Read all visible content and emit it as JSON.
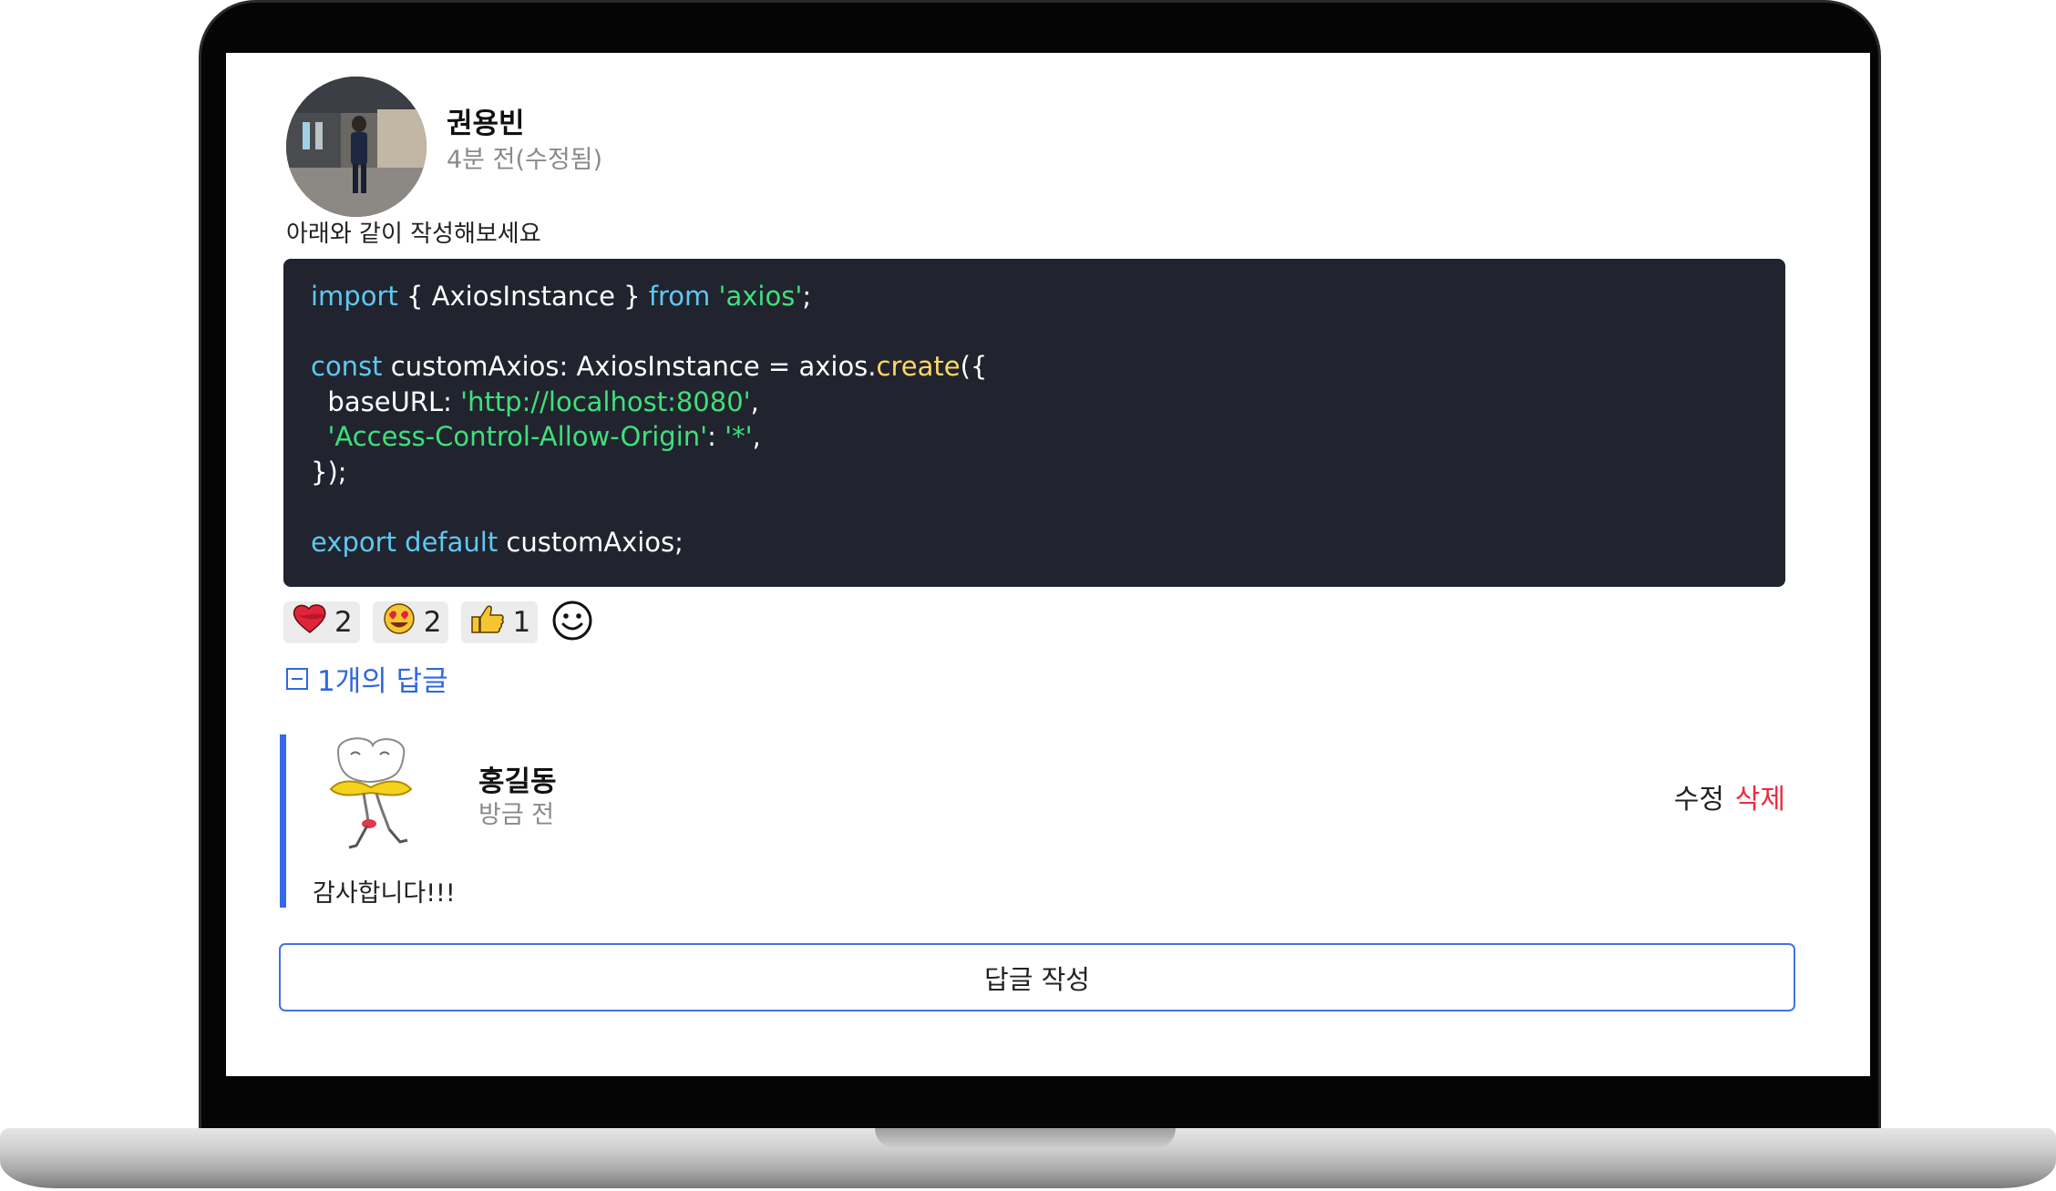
{
  "post": {
    "author": "권용빈",
    "time": "4분 전(수정됨)",
    "body": "아래와 같이 작성해보세요"
  },
  "code": {
    "lines": [
      [
        {
          "t": "import",
          "c": "kw"
        },
        {
          "t": " { AxiosInstance } ",
          "c": "punct"
        },
        {
          "t": "from",
          "c": "kw"
        },
        {
          "t": " ",
          "c": "punct"
        },
        {
          "t": "'axios'",
          "c": "str"
        },
        {
          "t": ";",
          "c": "punct"
        }
      ],
      [],
      [
        {
          "t": "const",
          "c": "kw"
        },
        {
          "t": " customAxios: AxiosInstance = axios.",
          "c": "punct"
        },
        {
          "t": "create",
          "c": "fn"
        },
        {
          "t": "({",
          "c": "punct"
        }
      ],
      [
        {
          "t": "  baseURL: ",
          "c": "punct"
        },
        {
          "t": "'http://localhost:8080'",
          "c": "str"
        },
        {
          "t": ",",
          "c": "punct"
        }
      ],
      [
        {
          "t": "  ",
          "c": "punct"
        },
        {
          "t": "'Access-Control-Allow-Origin'",
          "c": "str"
        },
        {
          "t": ": ",
          "c": "punct"
        },
        {
          "t": "'*'",
          "c": "str"
        },
        {
          "t": ",",
          "c": "punct"
        }
      ],
      [
        {
          "t": "});",
          "c": "punct"
        }
      ],
      [],
      [
        {
          "t": "export",
          "c": "kw"
        },
        {
          "t": " ",
          "c": "punct"
        },
        {
          "t": "default",
          "c": "kw"
        },
        {
          "t": " customAxios;",
          "c": "punct"
        }
      ]
    ]
  },
  "reactions": [
    {
      "icon": "heart-icon",
      "count": "2"
    },
    {
      "icon": "heart-eyes-icon",
      "count": "2"
    },
    {
      "icon": "thumbs-up-icon",
      "count": "1"
    }
  ],
  "replies_toggle": "1개의 답글",
  "reply": {
    "author": "홍길동",
    "time": "방금 전",
    "edit_label": "수정",
    "delete_label": "삭제",
    "body": "감사합니다!!!"
  },
  "write_reply_label": "답글 작성",
  "colors": {
    "accent": "#2f67e0",
    "delete": "#ec2a3f",
    "code_bg": "#21242e",
    "keyword": "#5ec8f2",
    "string": "#3ee07a",
    "function": "#ffd866"
  }
}
